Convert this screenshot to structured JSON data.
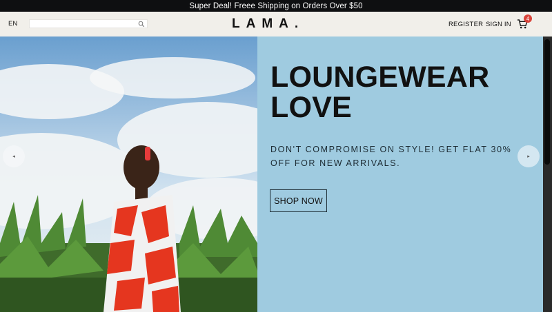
{
  "announcement": {
    "text": "Super Deal! Freee Shipping on Orders Over $50"
  },
  "navbar": {
    "language": "EN",
    "search": {
      "value": "",
      "placeholder": ""
    },
    "logo": "LAMA.",
    "links": {
      "register": "REGISTER",
      "signin": "SIGN IN"
    },
    "cart_count": "4"
  },
  "hero": {
    "title_line1": "LOUNGEWEAR",
    "title_line2": "LOVE",
    "description": "DON'T COMPROMISE ON STYLE! GET FLAT 30% OFF FOR NEW ARRIVALS.",
    "button_label": "SHOP NOW",
    "arrow_left": "◂",
    "arrow_right": "▸",
    "panel_color": "#9fcbe0"
  },
  "colors": {
    "announcement_bg": "#0e0f11",
    "navbar_bg": "#f1efea",
    "badge": "#d9433a"
  }
}
